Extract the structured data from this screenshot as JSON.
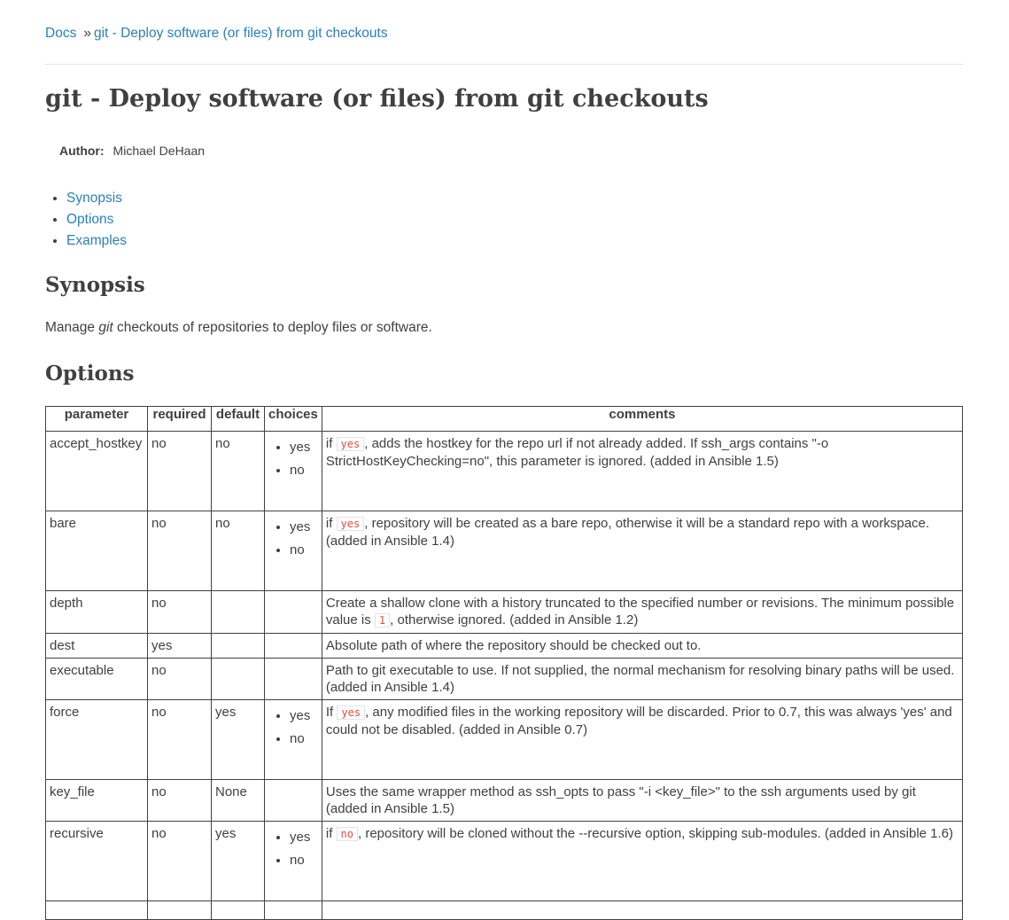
{
  "breadcrumb": {
    "root": "Docs",
    "separator": "»",
    "current": "git - Deploy software (or files) from git checkouts"
  },
  "title": "git - Deploy software (or files) from git checkouts",
  "author": {
    "label": "Author:",
    "name": "Michael DeHaan"
  },
  "toc": [
    "Synopsis",
    "Options",
    "Examples"
  ],
  "synopsis": {
    "heading": "Synopsis",
    "before": "Manage ",
    "em": "git",
    "after": " checkouts of repositories to deploy files or software."
  },
  "options": {
    "heading": "Options",
    "headers": [
      "parameter",
      "required",
      "default",
      "choices",
      "comments"
    ],
    "rows": [
      {
        "parameter": "accept_hostkey",
        "required": "no",
        "default": "no",
        "choices": [
          "yes",
          "no"
        ],
        "comment_pre": "if ",
        "comment_code": "yes",
        "comment_post": ", adds the hostkey for the repo url if not already added. If ssh_args contains \"-o StrictHostKeyChecking=no\", this parameter is ignored. (added in Ansible 1.5)"
      },
      {
        "parameter": "bare",
        "required": "no",
        "default": "no",
        "choices": [
          "yes",
          "no"
        ],
        "comment_pre": "if ",
        "comment_code": "yes",
        "comment_post": ", repository will be created as a bare repo, otherwise it will be a standard repo with a workspace. (added in Ansible 1.4)"
      },
      {
        "parameter": "depth",
        "required": "no",
        "default": "",
        "choices": [],
        "comment_pre": "Create a shallow clone with a history truncated to the specified number or revisions. The minimum possible value is ",
        "comment_code": "1",
        "comment_post": ", otherwise ignored. (added in Ansible 1.2)"
      },
      {
        "parameter": "dest",
        "required": "yes",
        "default": "",
        "choices": [],
        "comment_pre": "Absolute path of where the repository should be checked out to.",
        "comment_code": "",
        "comment_post": ""
      },
      {
        "parameter": "executable",
        "required": "no",
        "default": "",
        "choices": [],
        "comment_pre": "Path to git executable to use. If not supplied, the normal mechanism for resolving binary paths will be used. (added in Ansible 1.4)",
        "comment_code": "",
        "comment_post": ""
      },
      {
        "parameter": "force",
        "required": "no",
        "default": "yes",
        "choices": [
          "yes",
          "no"
        ],
        "comment_pre": "If ",
        "comment_code": "yes",
        "comment_post": ", any modified files in the working repository will be discarded. Prior to 0.7, this was always 'yes' and could not be disabled. (added in Ansible 0.7)"
      },
      {
        "parameter": "key_file",
        "required": "no",
        "default": "None",
        "choices": [],
        "comment_pre": "Uses the same wrapper method as ssh_opts to pass \"-i <key_file>\" to the ssh arguments used by git (added in Ansible 1.5)",
        "comment_code": "",
        "comment_post": ""
      },
      {
        "parameter": "recursive",
        "required": "no",
        "default": "yes",
        "choices": [
          "yes",
          "no"
        ],
        "comment_pre": "if ",
        "comment_code": "no",
        "comment_post": ", repository will be cloned without the --recursive option, skipping sub-modules. (added in Ansible 1.6)"
      }
    ]
  }
}
